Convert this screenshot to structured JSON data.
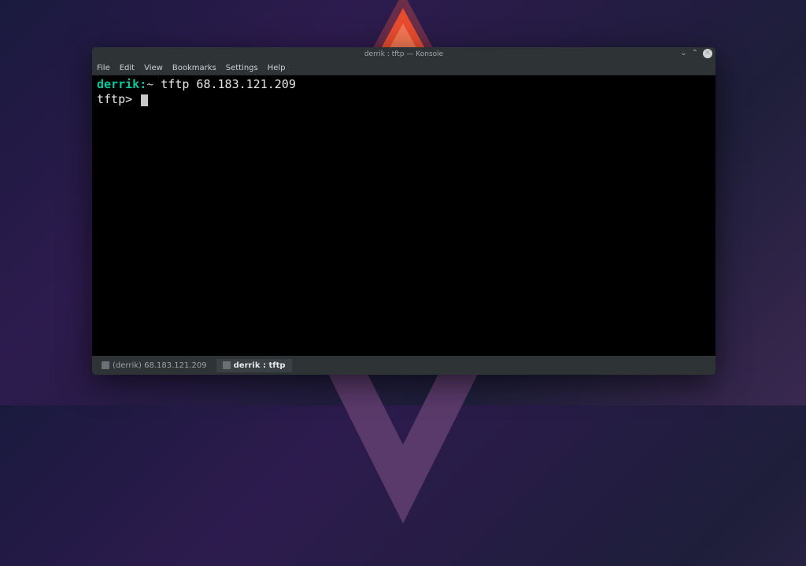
{
  "window": {
    "title": "derrik : tftp — Konsole"
  },
  "menubar": {
    "file": "File",
    "edit": "Edit",
    "view": "View",
    "bookmarks": "Bookmarks",
    "settings": "Settings",
    "help": "Help"
  },
  "terminal": {
    "line1": {
      "user": "derrik",
      "colon": ":",
      "path": "~",
      "command": " tftp 68.183.121.209"
    },
    "line2": {
      "prompt": "tftp> "
    }
  },
  "tabs": {
    "tab1": "(derrik) 68.183.121.209",
    "tab2": "derrik : tftp"
  }
}
